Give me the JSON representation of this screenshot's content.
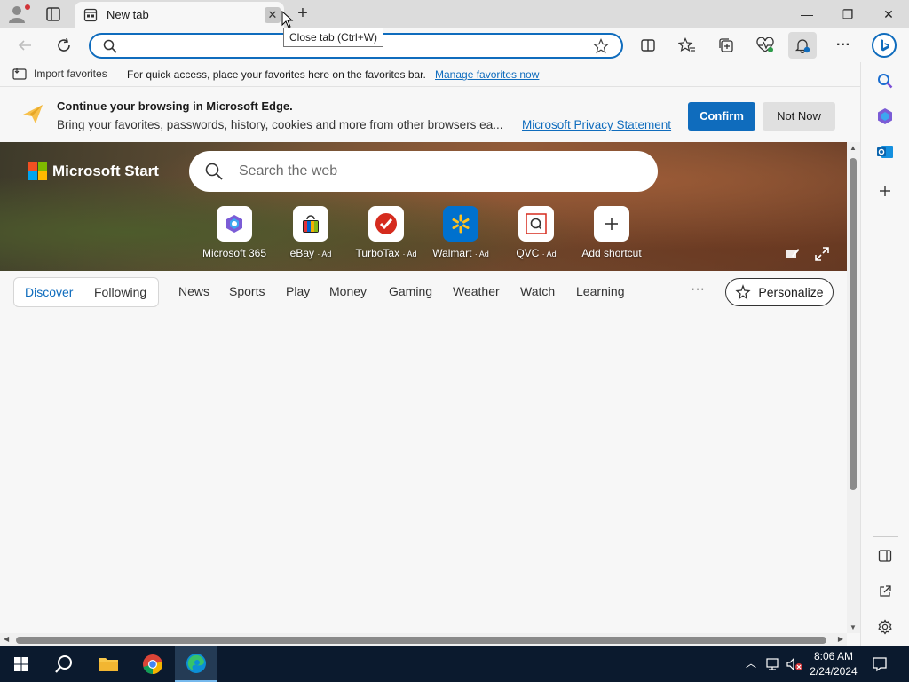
{
  "browser": {
    "tab": {
      "title": "New tab",
      "close_glyph": "✕"
    },
    "tooltip": "Close tab (Ctrl+W)",
    "window_controls": {
      "minimize": "—",
      "restore": "❐",
      "close": "✕"
    },
    "new_tab_glyph": "+"
  },
  "toolbar": {
    "address_placeholder": "",
    "address_value": "",
    "more_glyph": "···"
  },
  "favorites_bar": {
    "import_label": "Import favorites",
    "quick_access_text": "For quick access, place your favorites here on the favorites bar.",
    "manage_link": "Manage favorites now"
  },
  "banner": {
    "title": "Continue your browsing in Microsoft Edge.",
    "description": "Bring your favorites, passwords, history, cookies and more from other browsers ea...",
    "privacy_link": "Microsoft Privacy Statement",
    "confirm_label": "Confirm",
    "not_now_label": "Not Now"
  },
  "start": {
    "brand": "Microsoft Start",
    "search_placeholder": "Search the web",
    "shortcuts": [
      {
        "name": "Microsoft 365",
        "ad": ""
      },
      {
        "name": "eBay",
        "ad": "· Ad"
      },
      {
        "name": "TurboTax",
        "ad": "· Ad"
      },
      {
        "name": "Walmart",
        "ad": "· Ad"
      },
      {
        "name": "QVC",
        "ad": "· Ad"
      },
      {
        "name": "Add shortcut",
        "ad": ""
      }
    ]
  },
  "nav": {
    "discover": "Discover",
    "following": "Following",
    "items": [
      "News",
      "Sports",
      "Play",
      "Money",
      "Gaming",
      "Weather",
      "Watch",
      "Learning"
    ],
    "more": "···",
    "personalize": "Personalize"
  },
  "taskbar": {
    "time": "8:06 AM",
    "date": "2/24/2024"
  },
  "colors": {
    "accent": "#0f6cbd",
    "taskbar": "#0b1a2e"
  }
}
